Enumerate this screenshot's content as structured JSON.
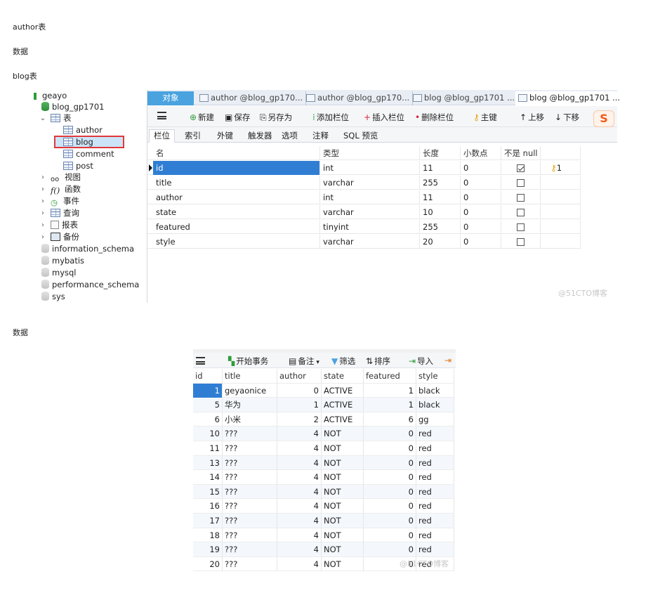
{
  "paragraphs": {
    "author_table": "author表",
    "data1": "数据",
    "blog_table": "blog表",
    "data2": "数据"
  },
  "navicat": {
    "tree": {
      "connection": "geayo",
      "database": "blog_gp1701",
      "tables_folder": "表",
      "tables": [
        "author",
        "blog",
        "comment",
        "post"
      ],
      "selected_table": "blog",
      "folders": [
        "视图",
        "函数",
        "事件",
        "查询",
        "报表",
        "备份"
      ],
      "other_databases": [
        "information_schema",
        "mybatis",
        "mysql",
        "performance_schema",
        "sys"
      ]
    },
    "tabs": {
      "objects": "对象",
      "tab1": "author @blog_gp170...",
      "tab2": "author @blog_gp170...",
      "tab3": "blog @blog_gp1701 ...",
      "tab4": "blog @blog_gp1701 ..."
    },
    "toolbar": {
      "new": "新建",
      "save": "保存",
      "save_as": "另存为",
      "add_field": "添加栏位",
      "insert_field": "插入栏位",
      "delete_field": "删除栏位",
      "primary_key": "主键",
      "move_up": "上移",
      "move_down": "下移",
      "ime_logo": "S"
    },
    "subtabs": [
      "栏位",
      "索引",
      "外键",
      "触发器",
      "选项",
      "注释",
      "SQL 预览"
    ],
    "columns_header": {
      "name": "名",
      "type": "类型",
      "length": "长度",
      "decimals": "小数点",
      "not_null": "不是 null"
    },
    "fields": [
      {
        "name": "id",
        "type": "int",
        "length": "11",
        "decimals": "0",
        "not_null": true,
        "key": "1"
      },
      {
        "name": "title",
        "type": "varchar",
        "length": "255",
        "decimals": "0",
        "not_null": false,
        "key": ""
      },
      {
        "name": "author",
        "type": "int",
        "length": "11",
        "decimals": "0",
        "not_null": false,
        "key": ""
      },
      {
        "name": "state",
        "type": "varchar",
        "length": "10",
        "decimals": "0",
        "not_null": false,
        "key": ""
      },
      {
        "name": "featured",
        "type": "tinyint",
        "length": "255",
        "decimals": "0",
        "not_null": false,
        "key": ""
      },
      {
        "name": "style",
        "type": "varchar",
        "length": "20",
        "decimals": "0",
        "not_null": false,
        "key": ""
      }
    ],
    "watermark": "@51CTO博客"
  },
  "data_view": {
    "toolbar": {
      "begin_transaction": "开始事务",
      "note": "备注",
      "filter": "筛选",
      "sort": "排序",
      "import": "导入"
    },
    "headers": [
      "id",
      "title",
      "author",
      "state",
      "featured",
      "style"
    ],
    "rows": [
      [
        "1",
        "geyaonice",
        "0",
        "ACTIVE",
        "1",
        "black"
      ],
      [
        "5",
        "华为",
        "1",
        "ACTIVE",
        "1",
        "black"
      ],
      [
        "6",
        "小米",
        "2",
        "ACTIVE",
        "6",
        "gg"
      ],
      [
        "10",
        "???",
        "4",
        "NOT",
        "0",
        "red"
      ],
      [
        "11",
        "???",
        "4",
        "NOT",
        "0",
        "red"
      ],
      [
        "13",
        "???",
        "4",
        "NOT",
        "0",
        "red"
      ],
      [
        "14",
        "???",
        "4",
        "NOT",
        "0",
        "red"
      ],
      [
        "15",
        "???",
        "4",
        "NOT",
        "0",
        "red"
      ],
      [
        "16",
        "???",
        "4",
        "NOT",
        "0",
        "red"
      ],
      [
        "17",
        "???",
        "4",
        "NOT",
        "0",
        "red"
      ],
      [
        "18",
        "???",
        "4",
        "NOT",
        "0",
        "red"
      ],
      [
        "19",
        "???",
        "4",
        "NOT",
        "0",
        "red"
      ],
      [
        "20",
        "???",
        "4",
        "NOT",
        "0",
        "red"
      ]
    ],
    "watermark": "@51CTO博客"
  }
}
